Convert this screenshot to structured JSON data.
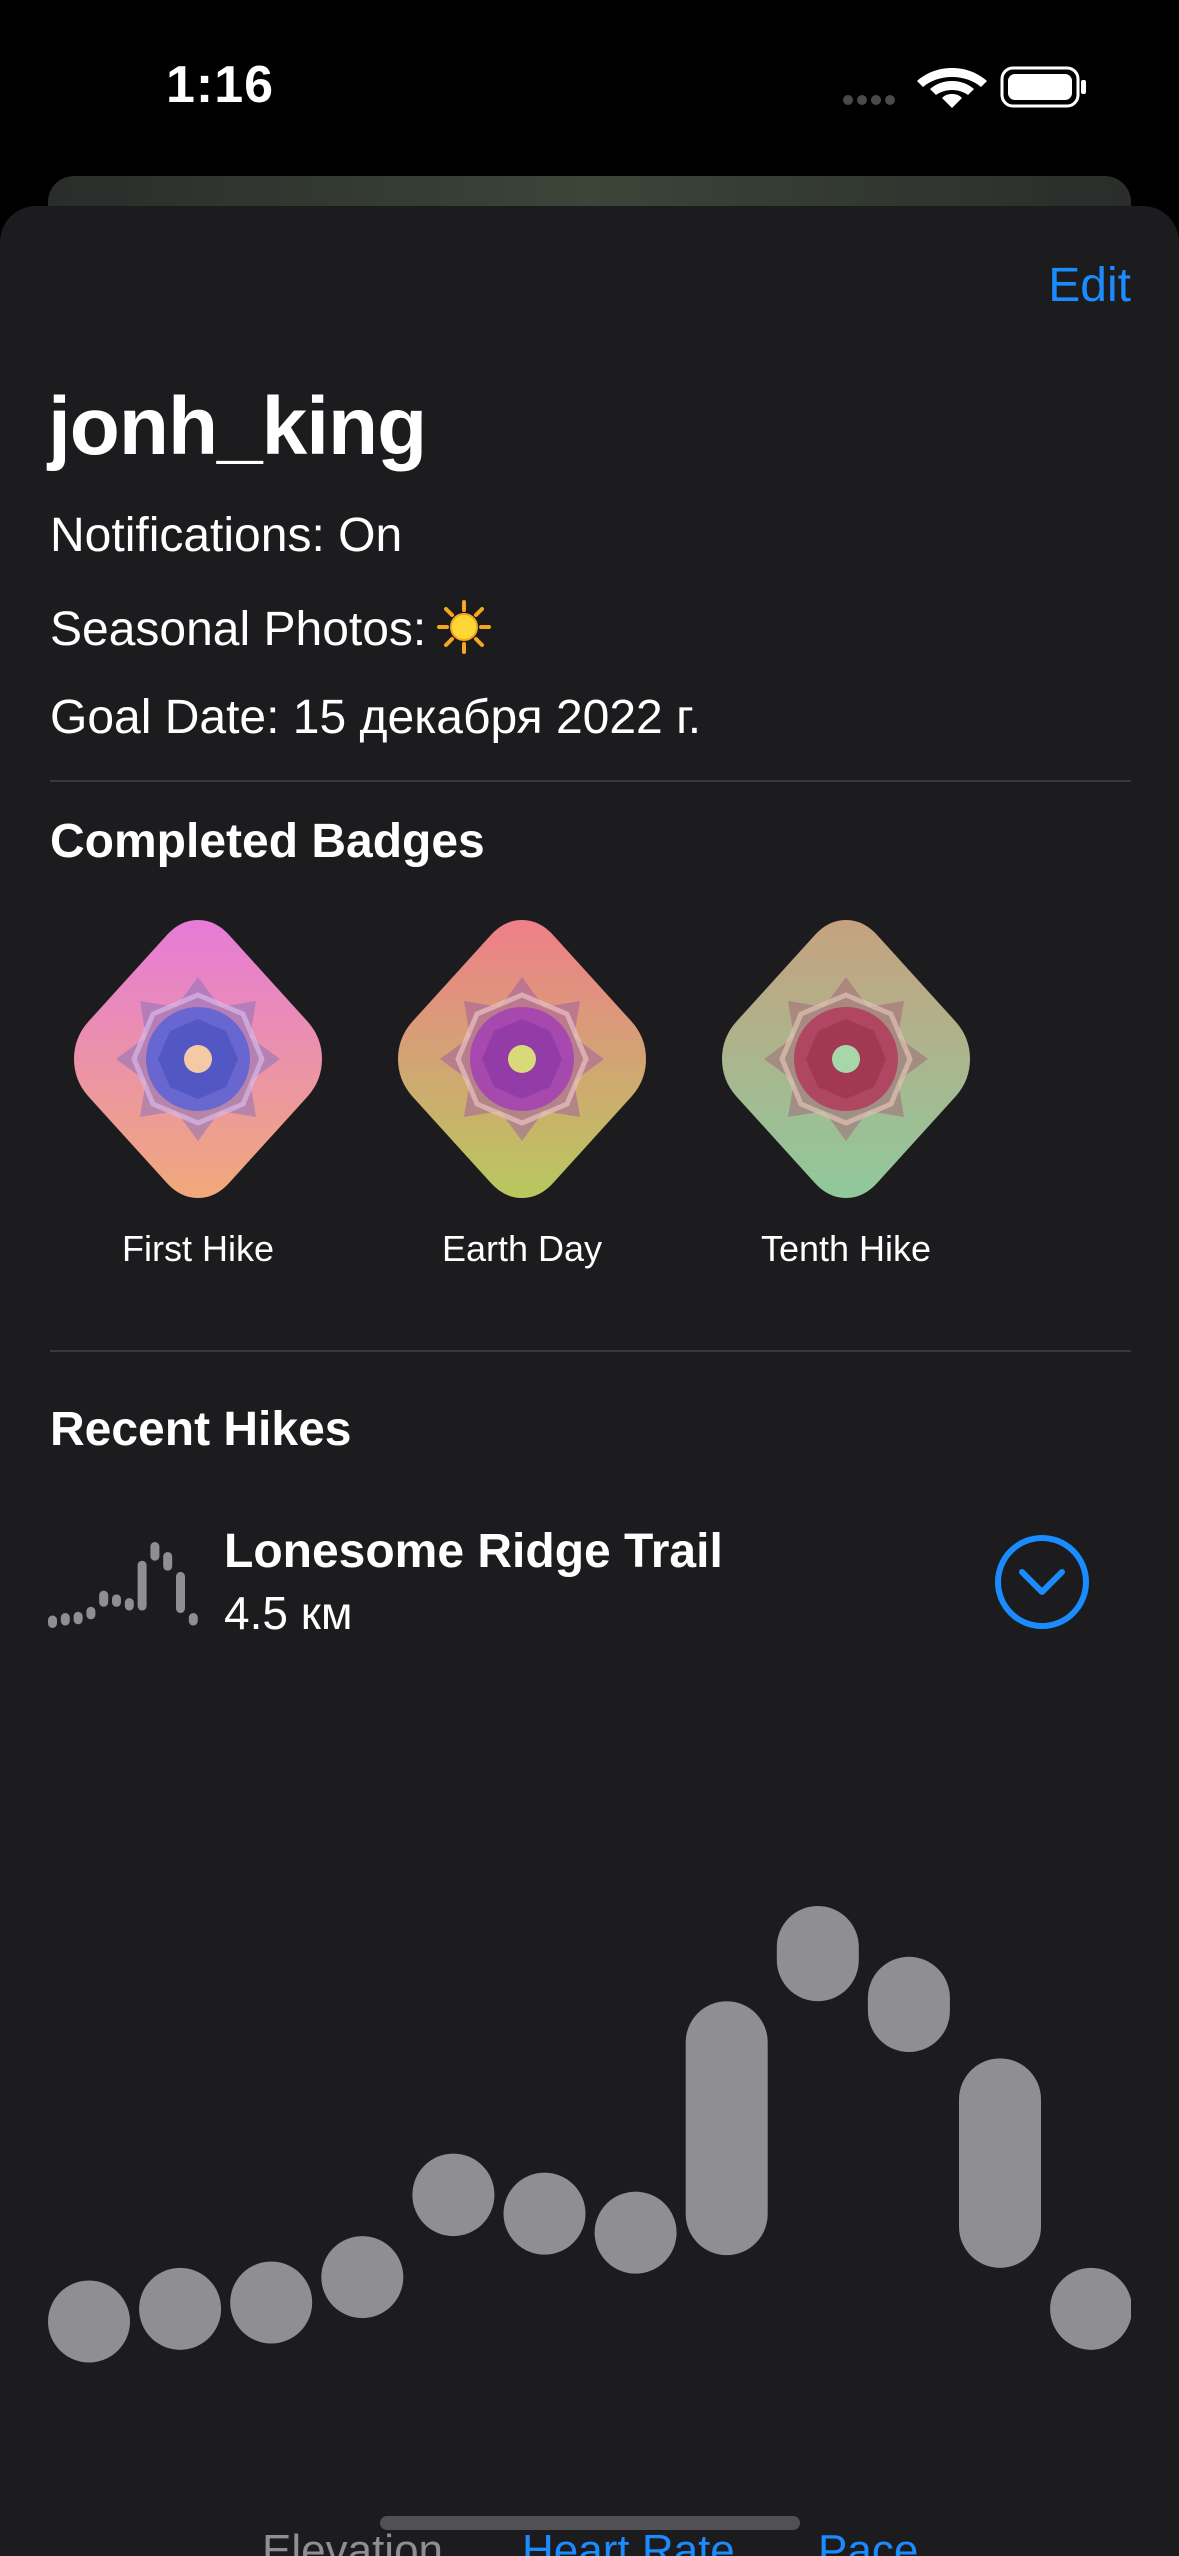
{
  "status_bar": {
    "time": "1:16"
  },
  "header": {
    "edit_label": "Edit"
  },
  "profile": {
    "username": "jonh_king",
    "notifications": "Notifications: On",
    "seasonal_photos": "Seasonal Photos:",
    "seasonal_icon": "sun-icon",
    "goal_date": "Goal Date: 15 декабря 2022 г."
  },
  "badges": {
    "title": "Completed Badges",
    "items": [
      {
        "label": "First Hike",
        "colors": [
          "#e67bd8",
          "#f0a97a"
        ],
        "center": "#5a63d6"
      },
      {
        "label": "Earth Day",
        "colors": [
          "#f07e8a",
          "#b7c95d"
        ],
        "center": "#a33fb4"
      },
      {
        "label": "Tenth Hike",
        "colors": [
          "#c6a27f",
          "#8fc99c"
        ],
        "center": "#b2365a"
      }
    ]
  },
  "recent": {
    "title": "Recent Hikes",
    "hike_name": "Lonesome Ridge Trail",
    "hike_distance": "4.5 км"
  },
  "chart_data": {
    "type": "bar",
    "note_series": "range capsules (floating bars), no axes or labels printed",
    "ranges": [
      [
        0.0,
        0.1
      ],
      [
        0.02,
        0.12
      ],
      [
        0.03,
        0.13
      ],
      [
        0.07,
        0.17
      ],
      [
        0.17,
        0.3
      ],
      [
        0.17,
        0.27
      ],
      [
        0.14,
        0.24
      ],
      [
        0.14,
        0.54
      ],
      [
        0.54,
        0.69
      ],
      [
        0.46,
        0.61
      ],
      [
        0.12,
        0.45
      ],
      [
        0.02,
        0.12
      ]
    ],
    "ylim": [
      0,
      0.69
    ],
    "bar_color": "#8e8e93"
  },
  "modes": {
    "items": [
      {
        "label": "Elevation",
        "active": true
      },
      {
        "label": "Heart Rate",
        "active": false
      },
      {
        "label": "Pace",
        "active": false
      }
    ],
    "active_color": "#8e8e93",
    "inactive_color": "#1a8cff"
  }
}
